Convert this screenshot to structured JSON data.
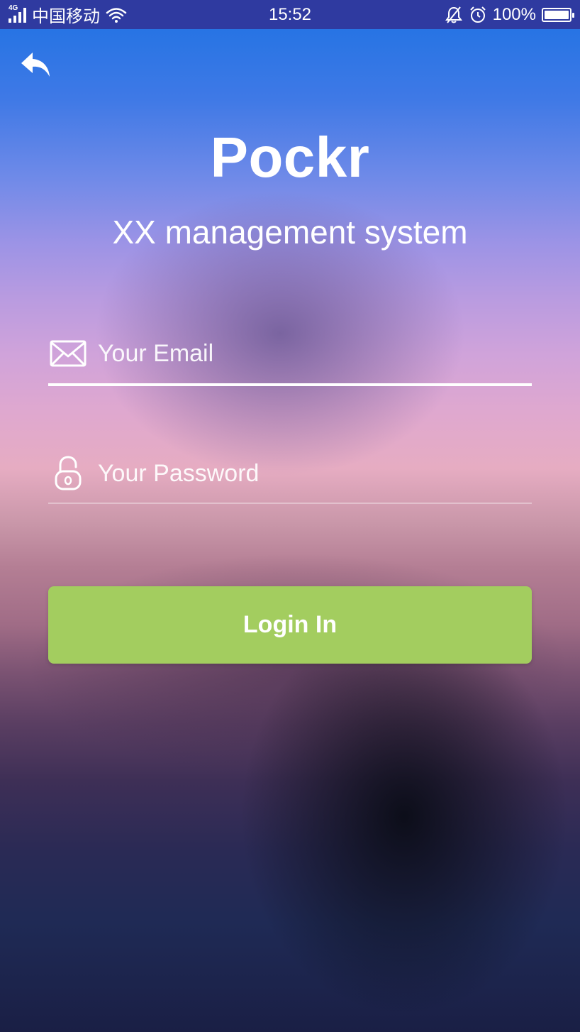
{
  "status_bar": {
    "network": "4G",
    "carrier": "中国移动",
    "time": "15:52",
    "battery": "100%",
    "battery_level": 1.0
  },
  "header": {
    "back_icon": "back-arrow-icon",
    "title": "Pockr",
    "subtitle": "XX management system"
  },
  "form": {
    "email": {
      "icon": "envelope-icon",
      "placeholder": "Your Email",
      "value": ""
    },
    "password": {
      "icon": "lock-icon",
      "placeholder": "Your Password",
      "value": ""
    },
    "submit_label": "Login In"
  },
  "colors": {
    "status_bar": "#2f3aa0",
    "button": "#a3cd5f",
    "text": "#ffffff"
  }
}
